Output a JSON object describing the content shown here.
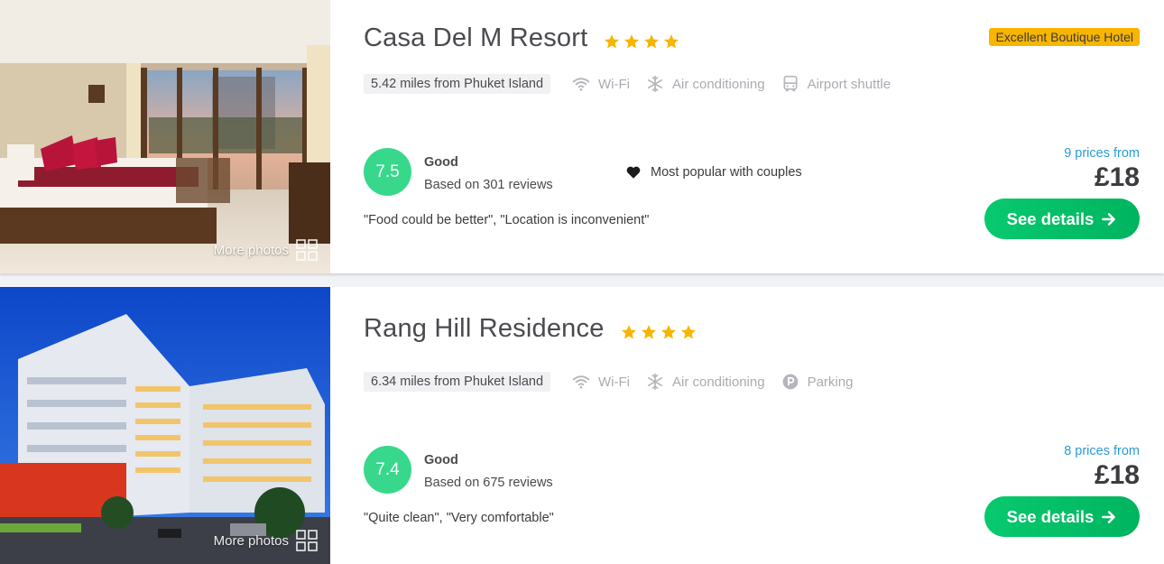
{
  "hotels": [
    {
      "name": "Casa Del M Resort",
      "stars": 4,
      "badge": "Excellent Boutique Hotel",
      "distance": "5.42 miles from Phuket Island",
      "amenities": [
        {
          "icon": "wifi-icon",
          "label": "Wi-Fi"
        },
        {
          "icon": "snowflake-icon",
          "label": "Air conditioning"
        },
        {
          "icon": "bus-icon",
          "label": "Airport shuttle"
        }
      ],
      "score": "7.5",
      "score_label": "Good",
      "reviews": "Based on 301 reviews",
      "popular": "Most popular with couples",
      "quote": "\"Food could be better\", \"Location is inconvenient\"",
      "prices_from": "9 prices from",
      "price": "£18",
      "cta": "See details",
      "more_photos": "More photos"
    },
    {
      "name": "Rang Hill Residence",
      "stars": 4,
      "distance": "6.34 miles from Phuket Island",
      "amenities": [
        {
          "icon": "wifi-icon",
          "label": "Wi-Fi"
        },
        {
          "icon": "snowflake-icon",
          "label": "Air conditioning"
        },
        {
          "icon": "parking-icon",
          "label": "Parking"
        }
      ],
      "score": "7.4",
      "score_label": "Good",
      "reviews": "Based on 675 reviews",
      "quote": "\"Quite clean\", \"Very comfortable\"",
      "prices_from": "8 prices from",
      "price": "£18",
      "cta": "See details",
      "more_photos": "More photos"
    }
  ],
  "colors": {
    "score": "#38d88c",
    "star": "#f7b500",
    "cta": "#08c96f",
    "link": "#2b9bd6",
    "badge": "#f7b500"
  }
}
